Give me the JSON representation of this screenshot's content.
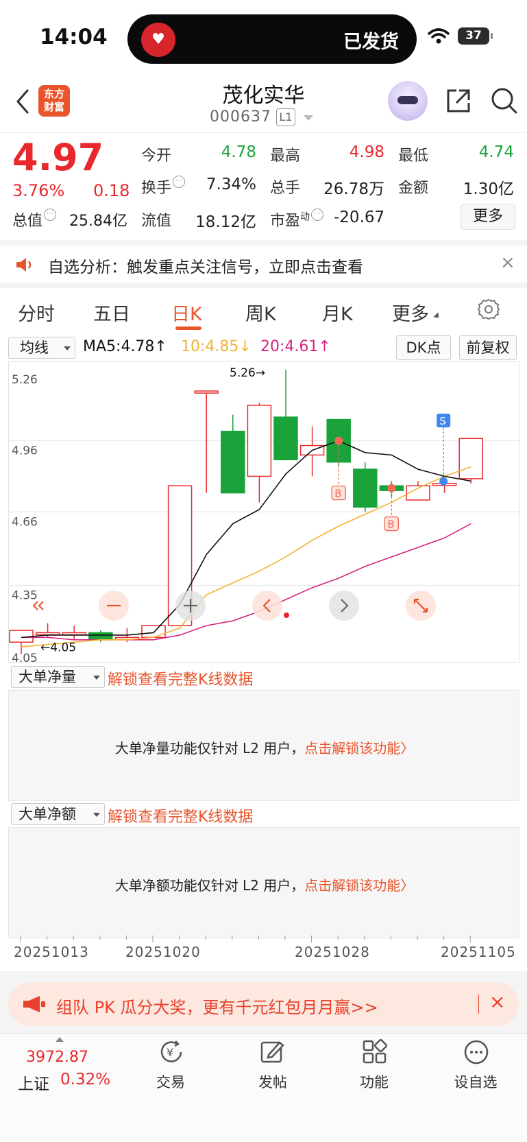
{
  "status_bar": {
    "time": "14:04",
    "island_text": "已发货",
    "battery": "37"
  },
  "header": {
    "brand": [
      "东方",
      "财富"
    ],
    "stock_name": "茂化实华",
    "stock_code": "000637",
    "level_badge": "L1"
  },
  "quote": {
    "price": "4.97",
    "change_pct": "3.76%",
    "change": "0.18",
    "open_label": "今开",
    "open": "4.78",
    "high_label": "最高",
    "high": "4.98",
    "low_label": "最低",
    "low": "4.74",
    "turnover_label": "换手",
    "turnover": "7.34%",
    "volume_label": "总手",
    "volume": "26.78万",
    "amount_label": "金额",
    "amount": "1.30亿",
    "total_cap_label": "总值",
    "total_cap": "25.84亿",
    "float_cap_label": "流值",
    "float_cap": "18.12亿",
    "pe_label": "市盈",
    "pe_sup": "动",
    "pe": "-20.67",
    "more_label": "更多"
  },
  "notice": {
    "text": "自选分析：触发重点关注信号，立即点击查看"
  },
  "tabs": [
    "分时",
    "五日",
    "日K",
    "周K",
    "月K",
    "更多"
  ],
  "active_tab": "日K",
  "ma_bar": {
    "select": "均线",
    "ma5": "MA5:4.78↑",
    "ma10": "10:4.85↓",
    "ma20": "20:4.61↑",
    "dk": "DK点",
    "adjust": "前复权"
  },
  "colors": {
    "up": "#e8282d",
    "down": "#19a33a",
    "ma5": "#111111",
    "ma10": "#f2b233",
    "ma20": "#d6247f",
    "accent": "#e8542b"
  },
  "chart_data": {
    "type": "candlestick",
    "y_ticks": [
      "5.26",
      "4.96",
      "4.66",
      "4.35",
      "4.05"
    ],
    "ylim": [
      4.05,
      5.26
    ],
    "max_label": "5.26→",
    "min_label": "←4.05",
    "candles": [
      {
        "o": 4.11,
        "h": 4.16,
        "l": 4.06,
        "c": 4.16
      },
      {
        "o": 4.15,
        "h": 4.19,
        "l": 4.13,
        "c": 4.15
      },
      {
        "o": 4.15,
        "h": 4.18,
        "l": 4.12,
        "c": 4.15
      },
      {
        "o": 4.15,
        "h": 4.16,
        "l": 4.11,
        "c": 4.12
      },
      {
        "o": 4.13,
        "h": 4.17,
        "l": 4.11,
        "c": 4.13
      },
      {
        "o": 4.13,
        "h": 4.18,
        "l": 4.13,
        "c": 4.18
      },
      {
        "o": 4.18,
        "h": 4.77,
        "l": 4.18,
        "c": 4.77
      },
      {
        "o": 5.17,
        "h": 5.17,
        "l": 4.74,
        "c": 5.17
      },
      {
        "o": 5.0,
        "h": 5.07,
        "l": 4.74,
        "c": 4.74
      },
      {
        "o": 4.81,
        "h": 5.12,
        "l": 4.7,
        "c": 5.11
      },
      {
        "o": 5.06,
        "h": 5.26,
        "l": 4.88,
        "c": 4.88
      },
      {
        "o": 4.9,
        "h": 5.02,
        "l": 4.81,
        "c": 4.94
      },
      {
        "o": 5.05,
        "h": 5.04,
        "l": 4.85,
        "c": 4.87
      },
      {
        "o": 4.84,
        "h": 4.87,
        "l": 4.66,
        "c": 4.68
      },
      {
        "o": 4.77,
        "h": 4.79,
        "l": 4.72,
        "c": 4.75
      },
      {
        "o": 4.71,
        "h": 4.79,
        "l": 4.71,
        "c": 4.77
      },
      {
        "o": 4.78,
        "h": 4.79,
        "l": 4.74,
        "c": 4.78
      },
      {
        "o": 4.8,
        "h": 4.97,
        "l": 4.78,
        "c": 4.97
      }
    ],
    "ma5": [
      4.13,
      4.14,
      4.14,
      4.14,
      4.14,
      4.15,
      4.27,
      4.48,
      4.61,
      4.67,
      4.82,
      4.92,
      4.96,
      4.91,
      4.9,
      4.84,
      4.81,
      4.79
    ],
    "ma10": [
      4.09,
      4.1,
      4.11,
      4.12,
      4.12,
      4.13,
      4.17,
      4.31,
      4.36,
      4.41,
      4.47,
      4.54,
      4.6,
      4.65,
      4.7,
      4.76,
      4.81,
      4.85
    ],
    "ma20": [
      4.13,
      4.13,
      4.12,
      4.12,
      4.12,
      4.12,
      4.14,
      4.18,
      4.2,
      4.24,
      4.29,
      4.34,
      4.38,
      4.43,
      4.47,
      4.51,
      4.55,
      4.61
    ],
    "signals": [
      {
        "type": "B",
        "index": 12
      },
      {
        "type": "B",
        "index": 14
      },
      {
        "type": "S",
        "index": 17
      }
    ],
    "x_labels": [
      "20251013",
      "20251020",
      "20251028",
      "20251105"
    ]
  },
  "sub_panels": [
    {
      "select": "大单净量",
      "unlock": "解锁查看完整K线数据",
      "msg": "大单净量功能仅针对 L2 用户，",
      "cta": "点击解锁该功能〉"
    },
    {
      "select": "大单净额",
      "unlock": "解锁查看完整K线数据",
      "msg": "大单净额功能仅针对 L2 用户，",
      "cta": "点击解锁该功能〉"
    }
  ],
  "banner": {
    "text": "组队 PK 瓜分大奖，更有千元红包月月赢>>"
  },
  "bottom_nav": {
    "index_value": "3972.87",
    "index_name": "上证",
    "index_pct": "0.32%",
    "items": [
      "交易",
      "发帖",
      "功能",
      "设自选"
    ]
  }
}
